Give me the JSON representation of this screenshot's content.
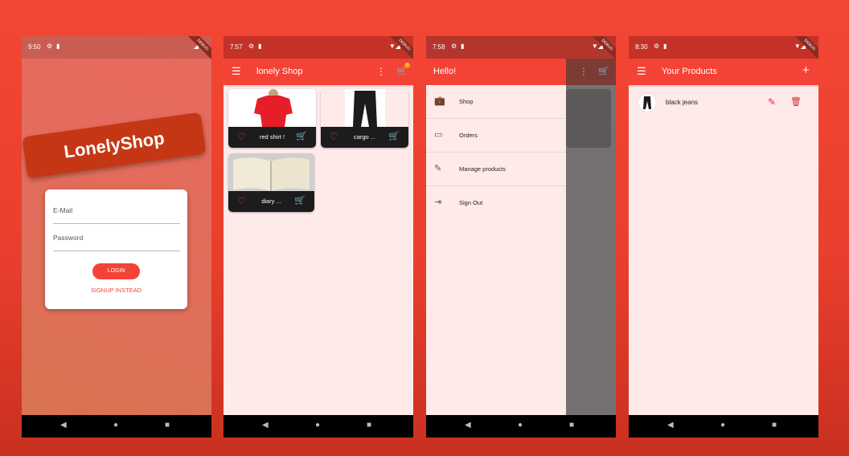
{
  "screens": {
    "login": {
      "time": "9:50",
      "logo_text": "LonelyShop",
      "email_label": "E-Mail",
      "password_label": "Password",
      "login_button": "LOGIN",
      "signup_link": "SIGNUP INSTEAD"
    },
    "shop": {
      "time": "7:57",
      "title": "lonely Shop",
      "cart_badge": "0",
      "products": [
        {
          "name": "red shirt !"
        },
        {
          "name": "cargo ..."
        },
        {
          "name": "diary ..."
        }
      ]
    },
    "drawer": {
      "time": "7:58",
      "header": "Hello!",
      "items": [
        {
          "label": "Shop",
          "icon": "store-icon"
        },
        {
          "label": "Orders",
          "icon": "credit-card-icon"
        },
        {
          "label": "Manage products",
          "icon": "edit-icon"
        },
        {
          "label": "Sign Out",
          "icon": "logout-icon"
        }
      ]
    },
    "products": {
      "time": "8:30",
      "title": "Your Products",
      "items": [
        {
          "name": "black jeans"
        }
      ]
    }
  },
  "debug_banner": "DEBUG",
  "colors": {
    "primary": "#f44336",
    "background": "#ffeaea",
    "logo_bg": "#c53714"
  }
}
